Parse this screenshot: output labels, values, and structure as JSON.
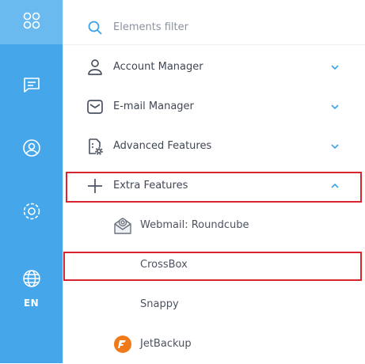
{
  "rail": {
    "items": [
      {
        "icon": "apps-grid-icon"
      },
      {
        "icon": "chat-icon"
      },
      {
        "icon": "user-circle-icon"
      },
      {
        "icon": "gear-icon"
      },
      {
        "icon": "globe-icon",
        "lang": "EN"
      }
    ],
    "background": "#45a7ea",
    "active_background": "#6bbaef"
  },
  "menu": {
    "search_placeholder": "Elements filter",
    "items": [
      {
        "label": "Account Manager",
        "icon": "user-icon",
        "chevron": "down"
      },
      {
        "label": "E-mail Manager",
        "icon": "envelope-icon",
        "chevron": "down"
      },
      {
        "label": "Advanced Features",
        "icon": "settings-document-icon",
        "chevron": "down"
      },
      {
        "label": "Extra Features",
        "icon": "plus-icon",
        "chevron": "up",
        "highlighted": true
      }
    ],
    "subitems": [
      {
        "label": "Webmail: Roundcube",
        "icon": "roundcube-icon"
      },
      {
        "label": "CrossBox",
        "highlighted": true
      },
      {
        "label": "Snappy"
      },
      {
        "label": "JetBackup",
        "icon": "jetbackup-icon"
      }
    ]
  },
  "colors": {
    "accent": "#3aa3e8",
    "highlight": "#d9252f",
    "text": "#3f4653"
  }
}
